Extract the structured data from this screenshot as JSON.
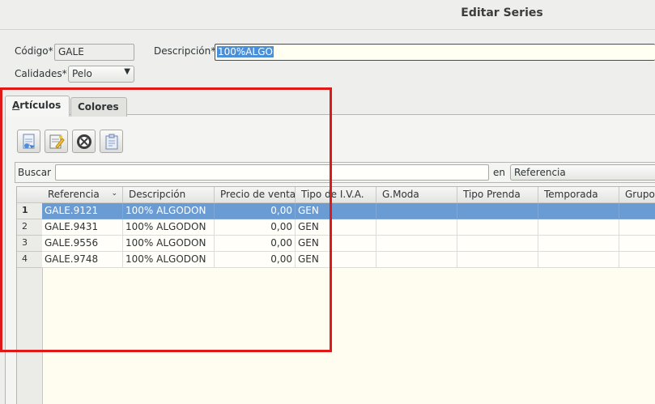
{
  "window": {
    "title": "Editar Series"
  },
  "form": {
    "codigo_label": "Código*",
    "codigo_value": "GALE",
    "descripcion_label": "Descripción*",
    "descripcion_value": "100%ALGO",
    "calidades_label": "Calidades*",
    "calidades_value": "Pelo"
  },
  "tabs": [
    {
      "label_first": "A",
      "label_rest": "rtículos",
      "active": true
    },
    {
      "label": "Colores",
      "active": false
    }
  ],
  "toolbar": {
    "buttons": [
      {
        "icon": "new-document-icon"
      },
      {
        "icon": "edit-document-icon"
      },
      {
        "icon": "delete-icon"
      },
      {
        "icon": "clipboard-icon"
      }
    ]
  },
  "search": {
    "label": "Buscar",
    "value": "",
    "in_label": "en",
    "field_value": "Referencia"
  },
  "table": {
    "columns": [
      "Referencia",
      "Descripción",
      "Precio de venta",
      "Tipo de I.V.A.",
      "G.Moda",
      "Tipo Prenda",
      "Temporada",
      "Grupo"
    ],
    "rows": [
      {
        "n": "1",
        "ref": "GALE.9121",
        "desc": "100% ALGODON",
        "precio": "0,00",
        "iva": "GEN"
      },
      {
        "n": "2",
        "ref": "GALE.9431",
        "desc": "100% ALGODON",
        "precio": "0,00",
        "iva": "GEN"
      },
      {
        "n": "3",
        "ref": "GALE.9556",
        "desc": "100% ALGODON",
        "precio": "0,00",
        "iva": "GEN"
      },
      {
        "n": "4",
        "ref": "GALE.9748",
        "desc": "100% ALGODON",
        "precio": "0,00",
        "iva": "GEN"
      }
    ],
    "selected_row": 0
  },
  "colors": {
    "highlight": "#e01818",
    "selection": "#6b9bd3"
  }
}
